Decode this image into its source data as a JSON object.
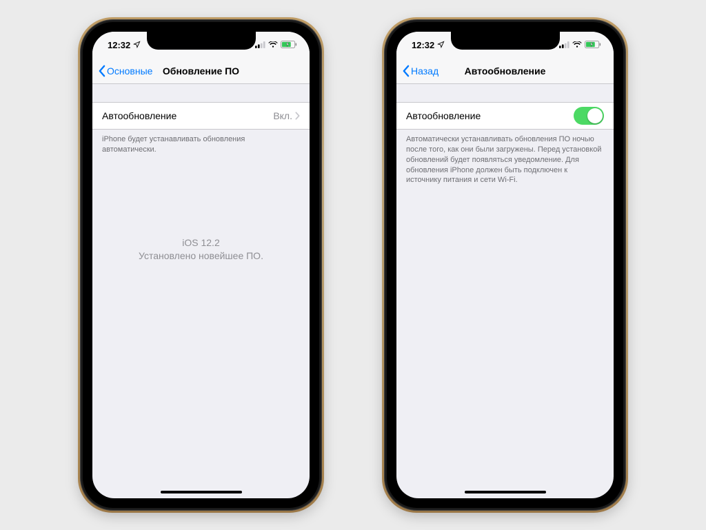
{
  "status": {
    "time": "12:32"
  },
  "left_phone": {
    "back_label": "Основные",
    "title": "Обновление ПО",
    "row_label": "Автообновление",
    "row_value": "Вкл.",
    "footer": "iPhone будет устанавливать обновления автоматически.",
    "center_line1": "iOS 12.2",
    "center_line2": "Установлено новейшее ПО."
  },
  "right_phone": {
    "back_label": "Назад",
    "title": "Автообновление",
    "row_label": "Автообновление",
    "toggle_on": true,
    "footer": "Автоматически устанавливать обновления ПО ночью после того, как они были загружены. Перед установкой обновлений будет появляться уведомление. Для обновления iPhone должен быть подключен к источнику питания и сети Wi-Fi."
  }
}
